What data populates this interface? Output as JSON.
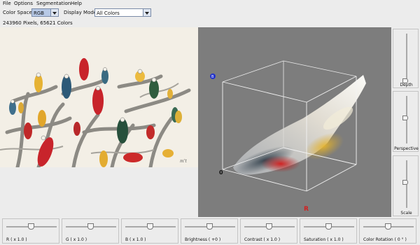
{
  "menubar": {
    "items": [
      "File",
      "Options",
      "Segmentation",
      "Help"
    ]
  },
  "toolbar": {
    "color_space_label": "Color Space:",
    "color_space_value": "RGB",
    "display_mode_label": "Display Mode:",
    "display_mode_value": "All Colors"
  },
  "info": {
    "text": "243960 Pixels,  65621 Colors"
  },
  "plot": {
    "origin_label": "0",
    "r_axis_label": "R",
    "b_axis_label": "B"
  },
  "side_sliders": [
    {
      "label": "Depth",
      "value": 0.0
    },
    {
      "label": "Perspective",
      "value": 0.5
    },
    {
      "label": "Scale",
      "value": 0.5
    }
  ],
  "bottom_sliders": [
    {
      "label": "R  ( x 1.0 )",
      "value": 0.5
    },
    {
      "label": "G  ( x 1.0 )",
      "value": 0.5
    },
    {
      "label": "B  ( x 1.0 )",
      "value": 0.5
    },
    {
      "label": "Brightness  ( +0 )",
      "value": 0.5
    },
    {
      "label": "Contrast  ( x 1.0 )",
      "value": 0.5
    },
    {
      "label": "Saturation  ( x 1.0 )",
      "value": 0.5
    },
    {
      "label": "Color Rotation  ( 0 ° )",
      "value": 0.5
    }
  ],
  "colors": {
    "select_highlight": "#b7c9e6",
    "plot_background": "#7d7d7d",
    "blue_axis": "#2233cc",
    "red_axis": "#d22020"
  },
  "icons": {
    "select_arrow": "chevron-down-icon"
  }
}
